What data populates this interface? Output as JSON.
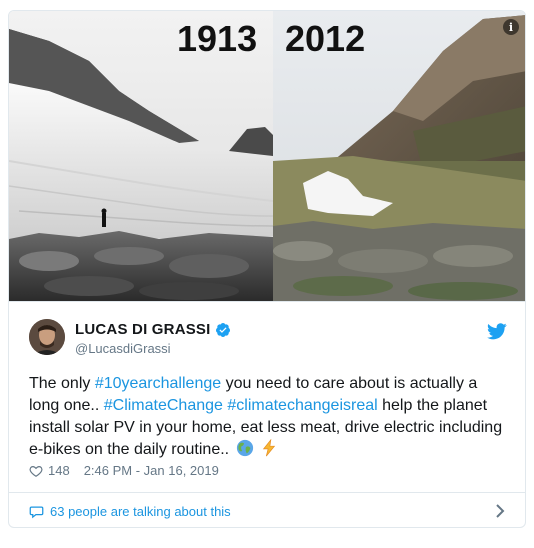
{
  "media": {
    "year_left": "1913",
    "year_right": "2012",
    "info_icon": "info-icon"
  },
  "author": {
    "display_name": "LUCAS DI GRASSI",
    "handle": "@LucasdiGrassi",
    "verified": true,
    "platform_icon": "twitter-bird-icon"
  },
  "tweet": {
    "segments": [
      {
        "text": "The only ",
        "type": "text"
      },
      {
        "text": "#10yearchallenge",
        "type": "hashtag"
      },
      {
        "text": " you need to care about is actually a long one.. ",
        "type": "text"
      },
      {
        "text": "#ClimateChange",
        "type": "hashtag"
      },
      {
        "text": " ",
        "type": "text"
      },
      {
        "text": "#climatechangeisreal",
        "type": "hashtag"
      },
      {
        "text": " help the planet install solar PV in your home, eat less meat, drive electric including e-bikes on the daily routine.. ",
        "type": "text"
      }
    ],
    "emojis": [
      "globe-emoji",
      "lightning-emoji"
    ]
  },
  "meta": {
    "like_count": "148",
    "timestamp": "2:46 PM - Jan 16, 2019"
  },
  "footer": {
    "talking_text": "63 people are talking about this"
  },
  "colors": {
    "link": "#1b95e0",
    "text": "#14171a",
    "muted": "#657786",
    "border": "#e1e8ed"
  }
}
